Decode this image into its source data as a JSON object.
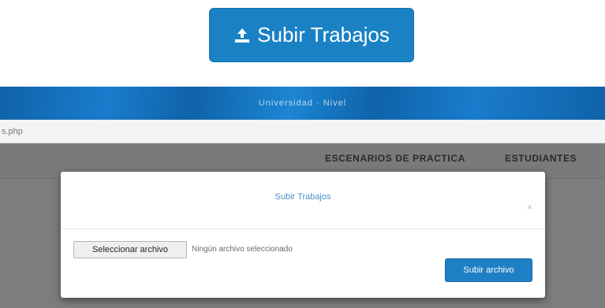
{
  "top_button": {
    "label": "Subir Trabajos",
    "icon": "upload-icon"
  },
  "app_header": {
    "brand_text": "Universidad · Nivel"
  },
  "url_bar": {
    "text": "s.php"
  },
  "nav": {
    "items": [
      {
        "label": "ESCENARIOS DE PRACTICA"
      },
      {
        "label": "ESTUDIANTES"
      }
    ]
  },
  "modal": {
    "title": "Subir Trabajos",
    "close_label": "×",
    "file_button_label": "Seleccionar archivo",
    "file_status": "Ningún archivo seleccionado",
    "submit_label": "Subir archivo"
  },
  "colors": {
    "primary": "#1a82c4",
    "header": "#0f63a8",
    "overlay": "#7d7d7d"
  }
}
